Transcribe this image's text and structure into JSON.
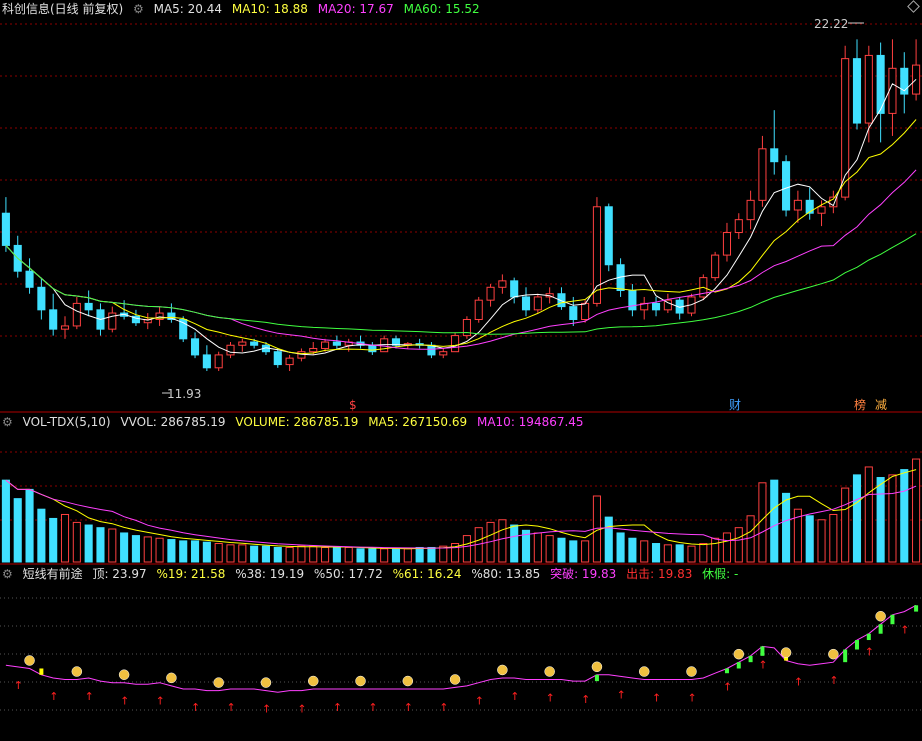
{
  "main_panel": {
    "title": "科创信息(日线 前复权)",
    "ma5_label": "MA5: 20.44",
    "ma10_label": "MA10: 18.88",
    "ma20_label": "MA20: 17.67",
    "ma60_label": "MA60: 15.52",
    "high_marker": "22.22",
    "low_marker": "11.93",
    "event_s": "$",
    "event_cai": "财",
    "event_bang": "榜",
    "event_jian": "减"
  },
  "volume_panel": {
    "indicator": "VOL-TDX(5,10)",
    "vvol_label": "VVOL: 286785.19",
    "volume_label": "VOLUME: 286785.19",
    "ma5_label": "MA5: 267150.69",
    "ma10_label": "MA10: 194867.45"
  },
  "signal_panel": {
    "indicator": "短线有前途",
    "top_label": "顶: 23.97",
    "p19_label": "%19: 21.58",
    "p38_label": "%38: 19.19",
    "p50_label": "%50: 17.72",
    "p61_label": "%61: 16.24",
    "p80_label": "%80: 13.85",
    "breakout_label": "突破: 19.83",
    "exit_label": "出击: 19.83",
    "rest_label": "休假: -"
  },
  "colors": {
    "up": "#ff4040",
    "down": "#40e0ff",
    "ma5": "#ffffff",
    "ma10": "#ffff00",
    "ma20": "#ff40ff",
    "ma60": "#40ff40",
    "grid": "#8b0000"
  },
  "chart_data": [
    {
      "type": "candlestick",
      "price_range": [
        11.0,
        22.8
      ],
      "ohlc": [
        [
          16.8,
          17.3,
          15.6,
          15.8
        ],
        [
          15.8,
          16.1,
          14.8,
          15.0
        ],
        [
          15.0,
          15.4,
          14.3,
          14.5
        ],
        [
          14.5,
          14.8,
          13.5,
          13.8
        ],
        [
          13.8,
          14.3,
          13.0,
          13.2
        ],
        [
          13.2,
          13.6,
          12.9,
          13.3
        ],
        [
          13.3,
          14.2,
          13.2,
          14.0
        ],
        [
          14.0,
          14.4,
          13.6,
          13.8
        ],
        [
          13.8,
          14.0,
          13.0,
          13.2
        ],
        [
          13.2,
          13.9,
          13.1,
          13.7
        ],
        [
          13.7,
          14.1,
          13.5,
          13.6
        ],
        [
          13.6,
          13.8,
          13.3,
          13.4
        ],
        [
          13.4,
          13.7,
          13.2,
          13.5
        ],
        [
          13.5,
          13.9,
          13.3,
          13.7
        ],
        [
          13.7,
          14.0,
          13.4,
          13.5
        ],
        [
          13.5,
          13.6,
          12.8,
          12.9
        ],
        [
          12.9,
          13.1,
          12.3,
          12.4
        ],
        [
          12.4,
          12.7,
          11.9,
          12.0
        ],
        [
          12.0,
          12.5,
          11.9,
          12.4
        ],
        [
          12.4,
          12.8,
          12.3,
          12.7
        ],
        [
          12.7,
          12.9,
          12.5,
          12.8
        ],
        [
          12.8,
          12.9,
          12.6,
          12.7
        ],
        [
          12.7,
          12.8,
          12.4,
          12.5
        ],
        [
          12.5,
          12.6,
          12.0,
          12.1
        ],
        [
          12.1,
          12.4,
          11.9,
          12.3
        ],
        [
          12.3,
          12.6,
          12.2,
          12.5
        ],
        [
          12.5,
          12.8,
          12.4,
          12.6
        ],
        [
          12.6,
          12.9,
          12.5,
          12.8
        ],
        [
          12.8,
          13.0,
          12.6,
          12.7
        ],
        [
          12.7,
          12.9,
          12.5,
          12.8
        ],
        [
          12.8,
          13.0,
          12.6,
          12.7
        ],
        [
          12.7,
          12.8,
          12.4,
          12.5
        ],
        [
          12.5,
          13.0,
          12.5,
          12.9
        ],
        [
          12.9,
          13.0,
          12.6,
          12.7
        ],
        [
          12.7,
          12.8,
          12.6,
          12.75
        ],
        [
          12.75,
          12.9,
          12.6,
          12.7
        ],
        [
          12.7,
          12.8,
          12.3,
          12.4
        ],
        [
          12.4,
          12.6,
          12.3,
          12.5
        ],
        [
          12.5,
          13.1,
          12.5,
          13.0
        ],
        [
          13.0,
          13.6,
          12.9,
          13.5
        ],
        [
          13.5,
          14.2,
          13.4,
          14.1
        ],
        [
          14.1,
          14.6,
          13.9,
          14.5
        ],
        [
          14.5,
          14.9,
          14.3,
          14.7
        ],
        [
          14.7,
          14.8,
          14.0,
          14.2
        ],
        [
          14.2,
          14.5,
          13.6,
          13.8
        ],
        [
          13.8,
          14.3,
          13.7,
          14.2
        ],
        [
          14.2,
          14.5,
          14.0,
          14.3
        ],
        [
          14.3,
          14.5,
          13.8,
          13.9
        ],
        [
          13.9,
          14.2,
          13.3,
          13.5
        ],
        [
          13.5,
          14.1,
          13.4,
          14.0
        ],
        [
          14.0,
          17.3,
          13.9,
          17.0
        ],
        [
          17.0,
          17.1,
          15.0,
          15.2
        ],
        [
          15.2,
          15.4,
          14.2,
          14.4
        ],
        [
          14.4,
          14.6,
          13.6,
          13.8
        ],
        [
          13.8,
          14.2,
          13.5,
          14.0
        ],
        [
          14.0,
          14.2,
          13.6,
          13.8
        ],
        [
          13.8,
          14.3,
          13.7,
          14.1
        ],
        [
          14.1,
          14.2,
          13.5,
          13.7
        ],
        [
          13.7,
          14.3,
          13.6,
          14.2
        ],
        [
          14.2,
          14.9,
          14.1,
          14.8
        ],
        [
          14.8,
          15.6,
          14.7,
          15.5
        ],
        [
          15.5,
          16.5,
          15.3,
          16.2
        ],
        [
          16.2,
          16.8,
          16.0,
          16.6
        ],
        [
          16.6,
          17.5,
          16.3,
          17.2
        ],
        [
          17.2,
          19.2,
          17.0,
          18.8
        ],
        [
          18.8,
          20.0,
          18.0,
          18.4
        ],
        [
          18.4,
          18.6,
          16.7,
          16.9
        ],
        [
          16.9,
          17.5,
          16.5,
          17.2
        ],
        [
          17.2,
          17.6,
          16.6,
          16.8
        ],
        [
          16.8,
          17.2,
          16.4,
          17.0
        ],
        [
          17.0,
          17.5,
          16.8,
          17.3
        ],
        [
          17.3,
          22.0,
          17.2,
          21.6
        ],
        [
          21.6,
          22.2,
          19.4,
          19.6
        ],
        [
          19.6,
          22.0,
          19.0,
          21.7
        ],
        [
          21.7,
          22.1,
          19.0,
          19.9
        ],
        [
          19.9,
          22.2,
          19.2,
          21.3
        ],
        [
          21.3,
          21.8,
          19.9,
          20.5
        ],
        [
          20.5,
          22.2,
          20.3,
          21.4
        ]
      ]
    },
    {
      "type": "bar",
      "name": "VOLUME",
      "values": [
        0.62,
        0.48,
        0.55,
        0.4,
        0.33,
        0.36,
        0.3,
        0.28,
        0.26,
        0.25,
        0.22,
        0.2,
        0.19,
        0.18,
        0.17,
        0.16,
        0.16,
        0.15,
        0.14,
        0.13,
        0.13,
        0.12,
        0.12,
        0.11,
        0.11,
        0.12,
        0.12,
        0.11,
        0.11,
        0.11,
        0.1,
        0.1,
        0.1,
        0.1,
        0.1,
        0.11,
        0.11,
        0.12,
        0.14,
        0.2,
        0.26,
        0.3,
        0.32,
        0.28,
        0.24,
        0.22,
        0.2,
        0.18,
        0.16,
        0.16,
        0.5,
        0.34,
        0.22,
        0.18,
        0.16,
        0.14,
        0.13,
        0.13,
        0.12,
        0.14,
        0.18,
        0.22,
        0.26,
        0.35,
        0.6,
        0.62,
        0.52,
        0.4,
        0.35,
        0.32,
        0.36,
        0.56,
        0.66,
        0.72,
        0.64,
        0.66,
        0.7,
        0.78
      ],
      "ylim": [
        0,
        1
      ]
    },
    {
      "type": "line",
      "name": "短线有前途",
      "values": [
        0.46,
        0.45,
        0.44,
        0.4,
        0.38,
        0.37,
        0.37,
        0.38,
        0.36,
        0.35,
        0.35,
        0.34,
        0.34,
        0.35,
        0.33,
        0.31,
        0.31,
        0.3,
        0.3,
        0.31,
        0.31,
        0.31,
        0.3,
        0.29,
        0.3,
        0.3,
        0.31,
        0.31,
        0.31,
        0.31,
        0.31,
        0.31,
        0.31,
        0.31,
        0.31,
        0.31,
        0.31,
        0.31,
        0.32,
        0.33,
        0.35,
        0.37,
        0.38,
        0.38,
        0.37,
        0.37,
        0.37,
        0.37,
        0.36,
        0.36,
        0.4,
        0.4,
        0.39,
        0.38,
        0.37,
        0.37,
        0.37,
        0.37,
        0.37,
        0.38,
        0.41,
        0.44,
        0.48,
        0.52,
        0.58,
        0.57,
        0.49,
        0.47,
        0.46,
        0.47,
        0.48,
        0.56,
        0.62,
        0.66,
        0.72,
        0.78,
        0.8,
        0.84
      ],
      "ylim": [
        0,
        1
      ]
    }
  ]
}
